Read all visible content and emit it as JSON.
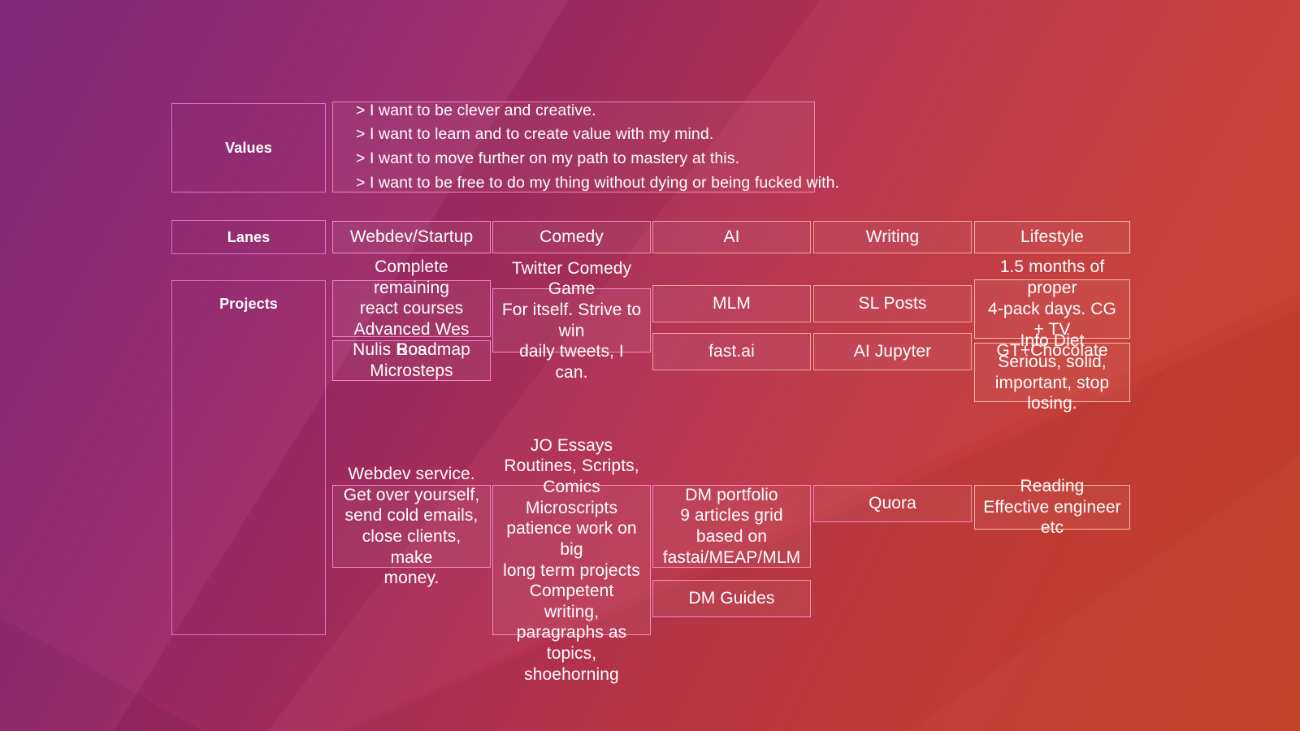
{
  "background": {
    "gradient_from": "#7b2176",
    "gradient_mid": "#b8334f",
    "gradient_to": "#ca4128"
  },
  "rows": {
    "values": {
      "label": "Values",
      "lines": [
        "> I want to be clever and creative.",
        "> I want to learn and to create value with my mind.",
        "> I want to move further on my path to mastery at this.",
        "> I want to be free to do my thing without dying or being fucked with."
      ]
    },
    "lanes": {
      "label": "Lanes",
      "items": [
        {
          "label": "Webdev/Startup"
        },
        {
          "label": "Comedy"
        },
        {
          "label": "AI"
        },
        {
          "label": "Writing"
        },
        {
          "label": "Lifestyle"
        }
      ]
    },
    "projects": {
      "label": "Projects",
      "columns": [
        {
          "lane": "Webdev/Startup",
          "top_cards": [
            "Complete remaining\nreact courses\nAdvanced Wes Bos",
            "Nulis Roadmap\nMicrosteps"
          ],
          "bottom_cards": [
            "Webdev service.\nGet over yourself,\nsend cold emails,\nclose clients, make\nmoney."
          ]
        },
        {
          "lane": "Comedy",
          "top_cards": [
            "Twitter Comedy Game\nFor itself. Strive to win\ndaily tweets, I can."
          ],
          "bottom_cards": [
            "JO Essays\nRoutines, Scripts,\nComics Microscripts\npatience work on big\nlong term projects\nCompetent writing,\nparagraphs as topics,\nshoehorning"
          ]
        },
        {
          "lane": "AI",
          "top_cards": [
            "MLM",
            "fast.ai"
          ],
          "bottom_cards": [
            "DM portfolio\n9 articles grid\nbased on\nfastai/MEAP/MLM",
            "DM Guides"
          ]
        },
        {
          "lane": "Writing",
          "top_cards": [
            "SL Posts",
            "AI Jupyter"
          ],
          "bottom_cards": [
            "Quora"
          ]
        },
        {
          "lane": "Lifestyle",
          "top_cards": [
            "1.5 months of proper\n4-pack days. CG + TV\nGT+Chocolate",
            "Info Diet\nSerious, solid,\nimportant, stop losing."
          ],
          "bottom_cards": [
            "Reading\nEffective engineer etc"
          ]
        }
      ]
    }
  }
}
